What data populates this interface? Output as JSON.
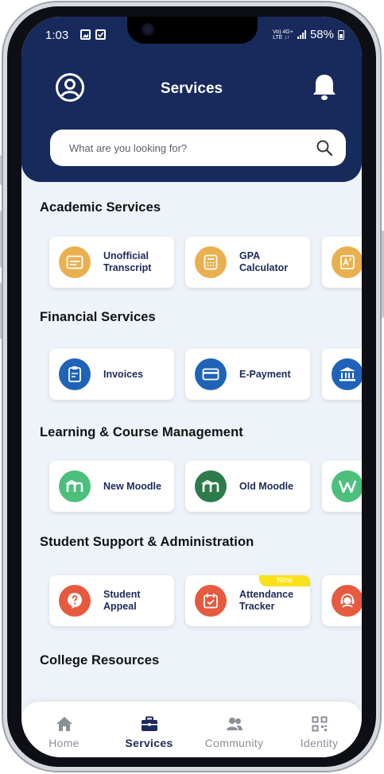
{
  "status_bar": {
    "time": "1:03",
    "network_top": "Vo) 4G+",
    "network_bottom": "LTE ↓↑",
    "battery": "58%"
  },
  "header": {
    "title": "Services"
  },
  "search": {
    "placeholder": "What are you looking for?"
  },
  "sections": [
    {
      "title": "Academic Services",
      "items": [
        {
          "label_line1": "Unofficial",
          "label_line2": "Transcript",
          "icon": "transcript-icon",
          "color": "#e9b04f"
        },
        {
          "label_line1": "GPA",
          "label_line2": "Calculator",
          "icon": "calculator-icon",
          "color": "#e9b04f"
        },
        {
          "label_line1": "",
          "label_line2": "",
          "icon": "certificate-icon",
          "color": "#e9b04f"
        }
      ]
    },
    {
      "title": "Financial Services",
      "items": [
        {
          "label_line1": "Invoices",
          "label_line2": "",
          "icon": "invoice-icon",
          "color": "#1f63b8"
        },
        {
          "label_line1": "E-Payment",
          "label_line2": "",
          "icon": "card-icon",
          "color": "#1f63b8"
        },
        {
          "label_line1": "",
          "label_line2": "",
          "icon": "bank-icon",
          "color": "#1f63b8"
        }
      ]
    },
    {
      "title": "Learning & Course Management",
      "items": [
        {
          "label_line1": "New Moodle",
          "label_line2": "",
          "icon": "moodle-icon",
          "color": "#4cbf7d"
        },
        {
          "label_line1": "Old Moodle",
          "label_line2": "",
          "icon": "moodle-icon",
          "color": "#2d7a4b"
        },
        {
          "label_line1": "",
          "label_line2": "",
          "icon": "w-letter-icon",
          "color": "#4cbf7d"
        }
      ]
    },
    {
      "title": "Student Support & Administration",
      "items": [
        {
          "label_line1": "Student",
          "label_line2": "Appeal",
          "icon": "question-icon",
          "color": "#e65a3f"
        },
        {
          "label_line1": "Attendance",
          "label_line2": "Tracker",
          "icon": "calendar-check-icon",
          "color": "#e65a3f",
          "badge": "New"
        },
        {
          "label_line1": "",
          "label_line2": "",
          "icon": "support-agent-icon",
          "color": "#e65a3f"
        }
      ]
    },
    {
      "title": "College Resources",
      "items": []
    }
  ],
  "bottom_nav": [
    {
      "label": "Home",
      "icon": "home-icon",
      "active": false
    },
    {
      "label": "Services",
      "icon": "briefcase-icon",
      "active": true
    },
    {
      "label": "Community",
      "icon": "people-icon",
      "active": false
    },
    {
      "label": "Identity",
      "icon": "qr-code-icon",
      "active": false
    }
  ],
  "colors": {
    "header_bg": "#182a5c",
    "screen_bg": "#eef2f9",
    "badge_new": "#f9e11b"
  }
}
